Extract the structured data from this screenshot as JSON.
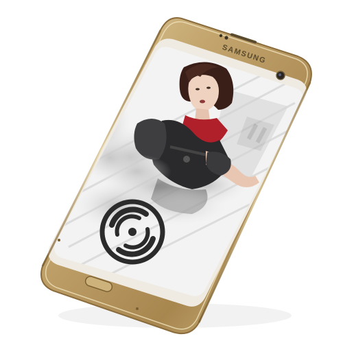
{
  "device": {
    "brand_label": "SAMSUNG",
    "model_style": "galaxy-s7-edge",
    "frame_color": "#b89a62",
    "frame_highlight": "#e3cfa0",
    "frame_shadow": "#7a5f33",
    "screen_bezel_color": "#f2eee6"
  },
  "screen": {
    "wallpaper": {
      "subject": "female-character-artwork",
      "background_color": "#f1f1f1",
      "smoke_color": "#c9c9c9",
      "hair_color": "#3a1f18",
      "outfit_color": "#b0202a",
      "vest_color": "#2a2a2c"
    },
    "logo": {
      "icon": "swirl-eye-logo-icon",
      "color": "#2b2b2b"
    }
  }
}
